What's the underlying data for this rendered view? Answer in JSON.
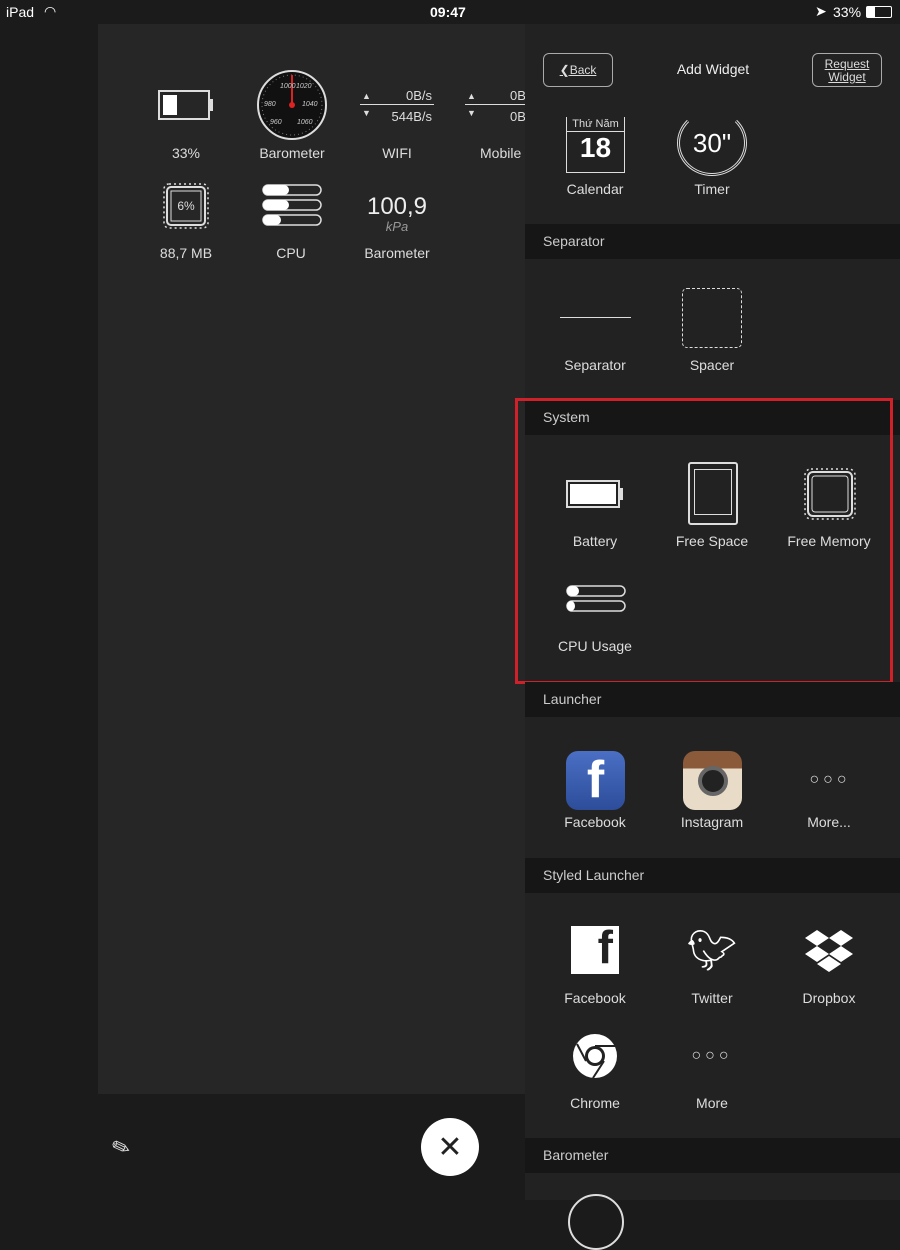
{
  "status": {
    "device": "iPad",
    "time": "09:47",
    "battery": "33%"
  },
  "dashboard": {
    "battery": {
      "value": "33%",
      "level": 0.33
    },
    "barometer_gauge": {
      "label": "Barometer",
      "ticks": [
        "960",
        "980",
        "1000",
        "1020",
        "1040",
        "1060"
      ]
    },
    "wifi": {
      "label": "WIFI",
      "up": "0B/s",
      "down": "544B/s"
    },
    "mobile": {
      "label": "Mobile",
      "up": "0B",
      "down": "0B"
    },
    "memory": {
      "value": "6%",
      "label": "88,7 MB"
    },
    "cpu": {
      "label": "CPU"
    },
    "barometer_value": {
      "value": "100,9",
      "unit": "kPa",
      "label": "Barometer"
    }
  },
  "header": {
    "back": "Back",
    "title": "Add Widget",
    "request": "Request Widget"
  },
  "top_items": [
    {
      "label": "Calendar",
      "day": "Thứ Năm",
      "date": "18"
    },
    {
      "label": "Timer",
      "value": "30\""
    }
  ],
  "sections": {
    "separator": {
      "title": "Separator",
      "items": [
        "Separator",
        "Spacer"
      ]
    },
    "system": {
      "title": "System",
      "items": [
        "Battery",
        "Free Space",
        "Free Memory",
        "CPU Usage"
      ]
    },
    "launcher": {
      "title": "Launcher",
      "items": [
        "Facebook",
        "Instagram",
        "More..."
      ]
    },
    "styled": {
      "title": "Styled Launcher",
      "items": [
        "Facebook",
        "Twitter",
        "Dropbox",
        "Chrome",
        "More"
      ]
    },
    "barometer": {
      "title": "Barometer"
    }
  },
  "colors": {
    "highlight": "#d0202a",
    "facebook": "#3b5998"
  }
}
